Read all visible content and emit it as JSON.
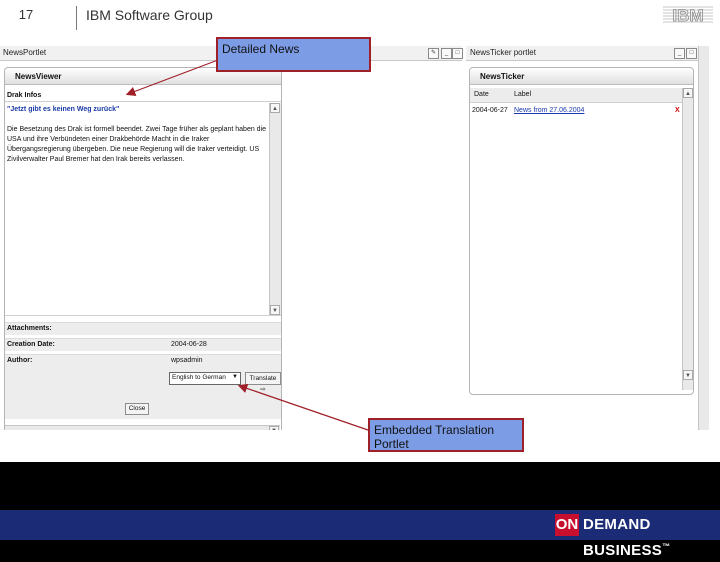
{
  "slide": {
    "number": "17",
    "group_title": "IBM Software Group",
    "logo_text": "IBM"
  },
  "app": {
    "left_window_title": "NewsPortlet",
    "right_window_title": "NewsTicker portlet"
  },
  "news_viewer": {
    "title": "NewsViewer",
    "subject": "Drak Infos",
    "headline": "\"Jetzt gibt es keinen Weg zurück\"",
    "body_lines": [
      "Die Besetzung des Drak ist formell beendet. Zwei Tage früher als geplant haben die",
      "USA und ihre Verbündeten einer Drakbehörde Macht in die Iraker",
      "Übergangsregierung übergeben. Die neue Regierung will die Iraker verteidigt. US",
      "Zivilverwalter Paul Bremer hat den Irak bereits verlassen."
    ],
    "attachments_label": "Attachments:",
    "creation_date_label": "Creation Date:",
    "creation_date_value": "2004-06-28",
    "author_label": "Author:",
    "author_value": "wpsadmin",
    "translation_select": "English to German",
    "translate_button": "Translate",
    "close_button": "Close"
  },
  "news_ticker": {
    "title": "NewsTicker",
    "col_date": "Date",
    "col_label": "Label",
    "rows": [
      {
        "date": "2004-06-27",
        "label": "News from 27.06.2004",
        "delete": "X"
      }
    ]
  },
  "callouts": {
    "detailed_news": "Detailed News",
    "translation_portlet": "Embedded Translation Portlet"
  },
  "footer": {
    "on": "ON",
    "text": "DEMAND BUSINESS",
    "tm": "™"
  },
  "colors": {
    "callout_fill": "#7c9ce6",
    "callout_border": "#a0202a",
    "arrow": "#a0202a",
    "footer_band": "#1b2b75",
    "link": "#1a3aa8"
  }
}
